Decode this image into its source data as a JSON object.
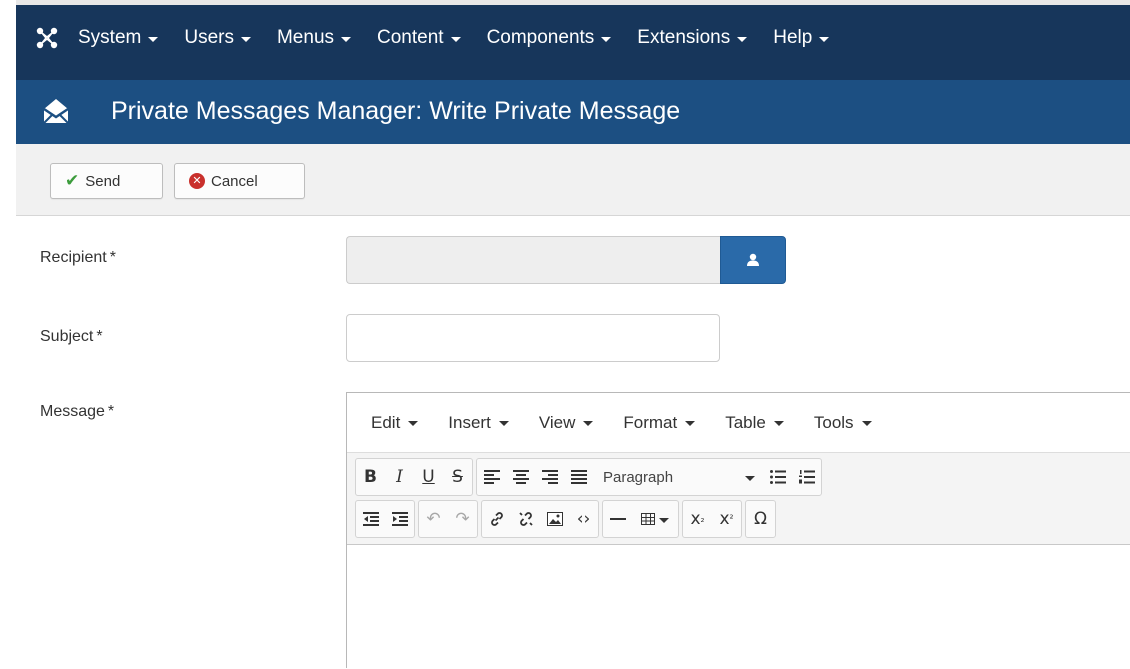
{
  "nav": {
    "items": [
      {
        "label": "System"
      },
      {
        "label": "Users"
      },
      {
        "label": "Menus"
      },
      {
        "label": "Content"
      },
      {
        "label": "Components"
      },
      {
        "label": "Extensions"
      },
      {
        "label": "Help"
      }
    ]
  },
  "header": {
    "title": "Private Messages Manager: Write Private Message",
    "icon": "envelope-open-icon"
  },
  "toolbar": {
    "send_label": "Send",
    "cancel_label": "Cancel"
  },
  "form": {
    "recipient_label": "Recipient",
    "subject_label": "Subject",
    "message_label": "Message",
    "required_marker": "*",
    "recipient_value": "",
    "subject_value": ""
  },
  "editor": {
    "menus": [
      {
        "label": "Edit"
      },
      {
        "label": "Insert"
      },
      {
        "label": "View"
      },
      {
        "label": "Format"
      },
      {
        "label": "Table"
      },
      {
        "label": "Tools"
      }
    ],
    "format_select": "Paragraph",
    "buttons": {
      "bold": "B",
      "italic": "I",
      "underline": "U",
      "strike": "S",
      "subscript": "x",
      "superscript": "x",
      "special_char": "Ω"
    },
    "content": ""
  },
  "colors": {
    "nav_bg": "#17365b",
    "header_bg": "#1c4f82",
    "accent_button": "#2a6aa9",
    "send_icon": "#3c9c3c",
    "cancel_icon": "#c9302c"
  }
}
